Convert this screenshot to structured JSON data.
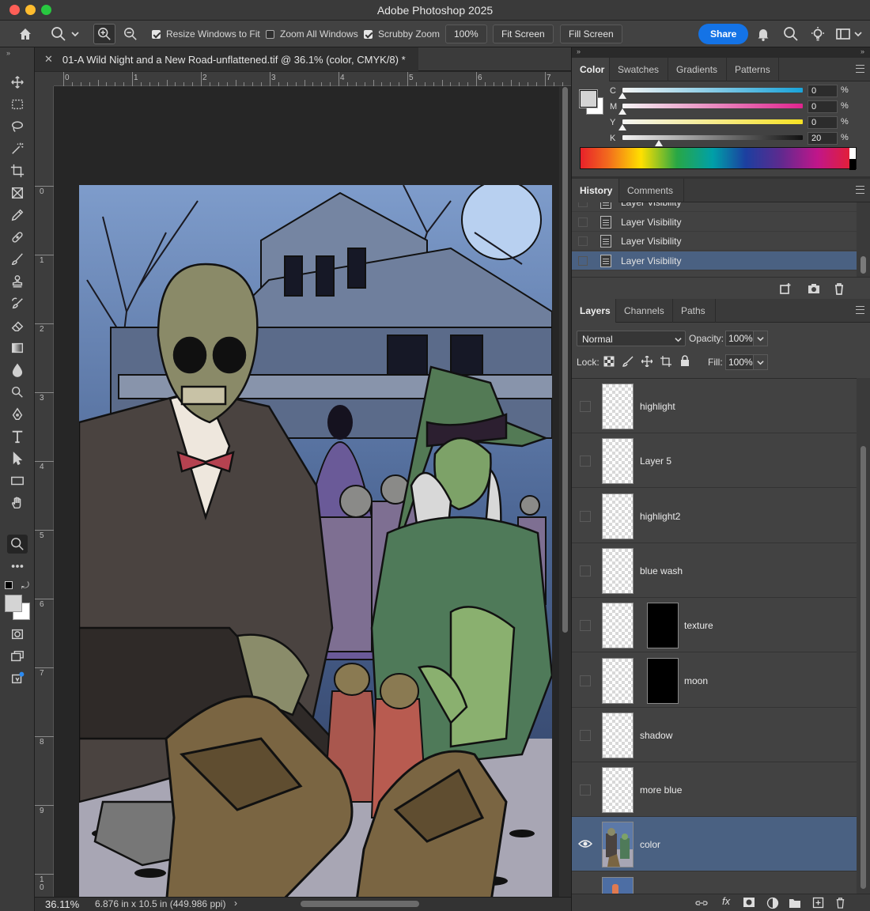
{
  "app": {
    "title": "Adobe Photoshop 2025"
  },
  "options": {
    "resize_windows": "Resize Windows to Fit",
    "zoom_all_windows": "Zoom All Windows",
    "scrubby_zoom": "Scrubby Zoom",
    "zoom_value": "100%",
    "fit_screen": "Fit Screen",
    "fill_screen": "Fill Screen",
    "share": "Share"
  },
  "document": {
    "tab_title": "01-A Wild Night and a New Road-unflattened.tif @ 36.1% (color, CMYK/8) *",
    "close_glyph": "✕",
    "ruler_top": [
      "0",
      "1",
      "2",
      "3",
      "4",
      "5",
      "6",
      "7"
    ],
    "ruler_left": [
      "0",
      "1",
      "2",
      "3",
      "4",
      "5",
      "6",
      "7",
      "8",
      "9",
      "1\n0"
    ],
    "zoom": "36.11%",
    "doc_info": "6.876 in x 10.5 in (449.986 ppi)",
    "status_arrow": "›"
  },
  "color_panel": {
    "tabs": [
      "Color",
      "Swatches",
      "Gradients",
      "Patterns"
    ],
    "channels": [
      {
        "label": "C",
        "value": "0",
        "pct": "%",
        "level": 0
      },
      {
        "label": "M",
        "value": "0",
        "pct": "%",
        "level": 0
      },
      {
        "label": "Y",
        "value": "0",
        "pct": "%",
        "level": 0
      },
      {
        "label": "K",
        "value": "20",
        "pct": "%",
        "level": 20
      }
    ]
  },
  "history_panel": {
    "tabs": [
      "History",
      "Comments"
    ],
    "items": [
      "Layer Visibility",
      "Layer Visibility",
      "Layer Visibility",
      "Layer Visibility"
    ]
  },
  "layers_panel": {
    "tabs": [
      "Layers",
      "Channels",
      "Paths"
    ],
    "blend_mode": "Normal",
    "opacity_label": "Opacity:",
    "opacity": "100%",
    "lock_label": "Lock:",
    "fill_label": "Fill:",
    "fill": "100%",
    "layers": [
      {
        "name": "highlight",
        "mask": false,
        "visible": false
      },
      {
        "name": "Layer 5",
        "mask": false,
        "visible": false
      },
      {
        "name": "highlight2",
        "mask": false,
        "visible": false
      },
      {
        "name": "blue wash",
        "mask": false,
        "visible": false
      },
      {
        "name": "texture",
        "mask": true,
        "visible": false
      },
      {
        "name": "moon",
        "mask": true,
        "visible": false
      },
      {
        "name": "shadow",
        "mask": false,
        "visible": false
      },
      {
        "name": "more blue",
        "mask": false,
        "visible": false
      },
      {
        "name": "color",
        "mask": false,
        "visible": true
      }
    ]
  },
  "colors": {
    "accent": "#1473e6",
    "selection": "#4a6182"
  }
}
